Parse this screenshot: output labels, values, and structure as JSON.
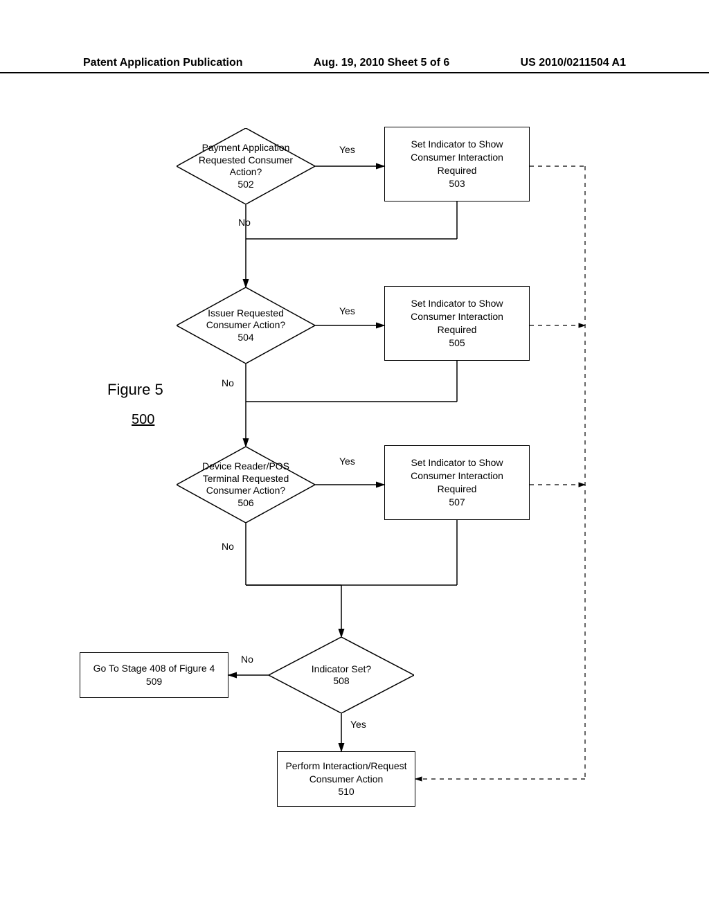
{
  "header": {
    "left": "Patent Application Publication",
    "mid": "Aug. 19, 2010  Sheet 5 of 6",
    "right": "US 2010/0211504 A1"
  },
  "figure": {
    "title": "Figure 5",
    "number": "500"
  },
  "labels": {
    "yes1": "Yes",
    "yes2": "Yes",
    "yes3": "Yes",
    "yes4": "Yes",
    "no1": "No",
    "no2": "No",
    "no3": "No",
    "no4": "No"
  },
  "nodes": {
    "d502": "Payment Application Requested Consumer Action?\n502",
    "r503": "Set Indicator to Show Consumer Interaction Required\n503",
    "d504": "Issuer Requested Consumer Action?\n504",
    "r505": "Set Indicator to Show Consumer Interaction Required\n505",
    "d506": "Device Reader/POS Terminal Requested Consumer Action?\n506",
    "r507": "Set Indicator to Show Consumer Interaction Required\n507",
    "d508": "Indicator Set?\n508",
    "r509": "Go To Stage 408 of Figure 4\n509",
    "r510": "Perform Interaction/Request Consumer Action\n510"
  }
}
